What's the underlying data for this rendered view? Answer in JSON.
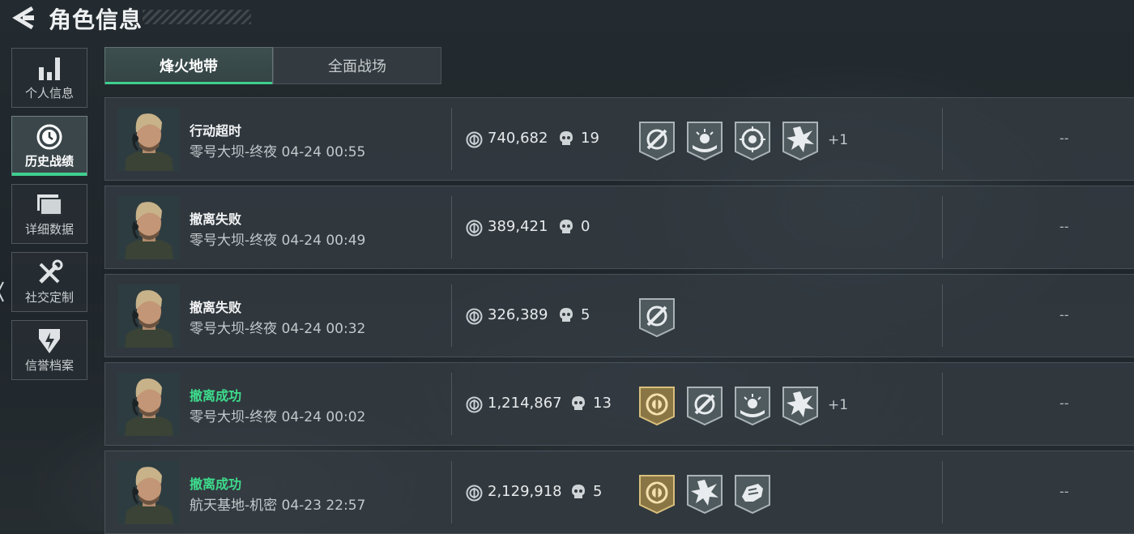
{
  "header": {
    "title": "角色信息",
    "back_icon": "back-arrow-icon"
  },
  "side_nav": [
    {
      "label": "个人信息",
      "icon": "bar-chart-icon",
      "active": false
    },
    {
      "label": "历史战绩",
      "icon": "history-clock-icon",
      "active": true
    },
    {
      "label": "详细数据",
      "icon": "folder-icon",
      "active": false
    },
    {
      "label": "社交定制",
      "icon": "tools-icon",
      "active": false
    },
    {
      "label": "信誉档案",
      "icon": "reputation-shield-icon",
      "active": false
    }
  ],
  "tabs": [
    {
      "label": "烽火地带",
      "active": true
    },
    {
      "label": "全面战场",
      "active": false
    }
  ],
  "colors": {
    "accent": "#3fcf8e",
    "success_text": "#3ddc8c",
    "gold_badge": "#c9a95c"
  },
  "matches": [
    {
      "result": "行动超时",
      "success": false,
      "map_time": "零号大坝-终夜 04-24 00:55",
      "value": "740,682",
      "kills": "19",
      "badges": [
        "crosshair-badge-icon",
        "sunrise-badge-icon",
        "skull-target-badge-icon",
        "burst-badge-icon"
      ],
      "more": "+1",
      "extra": "--"
    },
    {
      "result": "撤离失败",
      "success": false,
      "map_time": "零号大坝-终夜 04-24 00:49",
      "value": "389,421",
      "kills": "0",
      "badges": [],
      "more": "",
      "extra": "--"
    },
    {
      "result": "撤离失败",
      "success": false,
      "map_time": "零号大坝-终夜 04-24 00:32",
      "value": "326,389",
      "kills": "5",
      "badges": [
        "crosshair-badge-icon"
      ],
      "more": "",
      "extra": "--"
    },
    {
      "result": "撤离成功",
      "success": true,
      "map_time": "零号大坝-终夜 04-24 00:02",
      "value": "1,214,867",
      "kills": "13",
      "badges": [
        "gold-emblem-badge-icon",
        "crosshair-badge-icon",
        "sunrise-badge-icon",
        "burst-badge-icon"
      ],
      "more": "+1",
      "extra": "--"
    },
    {
      "result": "撤离成功",
      "success": true,
      "map_time": "航天基地-机密 04-23 22:57",
      "value": "2,129,918",
      "kills": "5",
      "badges": [
        "gold-emblem-badge-icon",
        "burst-badge-icon",
        "fist-badge-icon"
      ],
      "more": "",
      "extra": "--"
    }
  ]
}
